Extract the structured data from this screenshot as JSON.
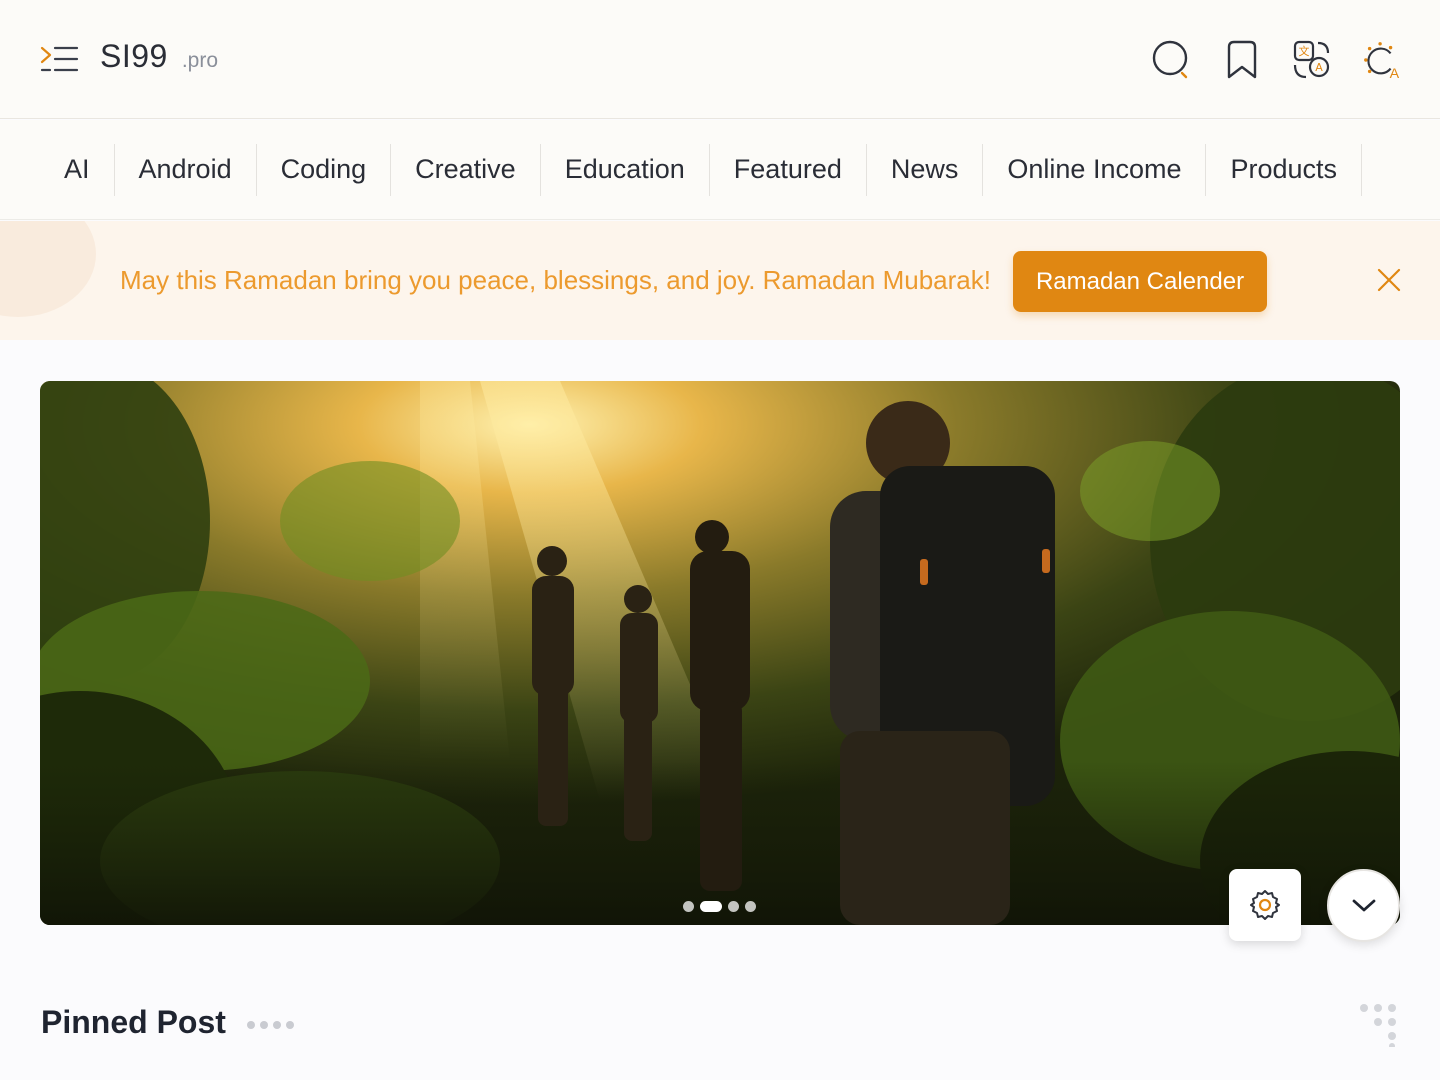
{
  "header": {
    "brand_name": "SI99",
    "brand_tld": ".pro",
    "icons": [
      "menu-icon",
      "search-icon",
      "bookmark-icon",
      "translate-icon",
      "theme-toggle-icon"
    ],
    "accent": "#e08712"
  },
  "categories": [
    "AI",
    "Android",
    "Coding",
    "Creative",
    "Education",
    "Featured",
    "News",
    "Online Income",
    "Products"
  ],
  "banner": {
    "message": "May this Ramadan bring you peace, blessings, and joy. Ramadan Mubarak!",
    "button_label": "Ramadan Calender",
    "text_color": "#ec9a2e",
    "button_color": "#e08712"
  },
  "hero": {
    "slide_count": 4,
    "active_slide": 2
  },
  "section": {
    "title": "Pinned Post"
  }
}
